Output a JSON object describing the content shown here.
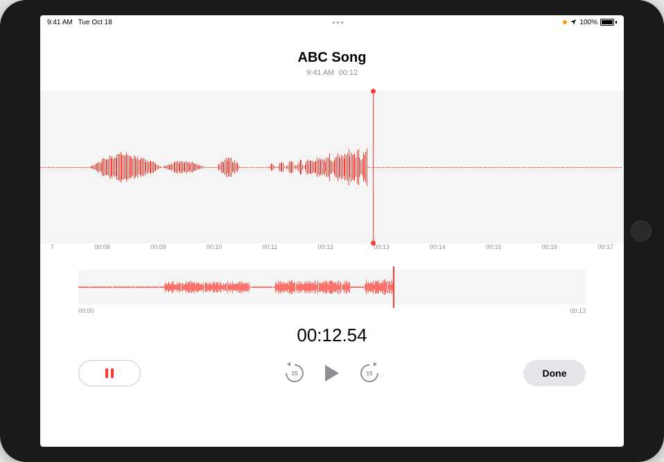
{
  "status_bar": {
    "time": "9:41 AM",
    "date": "Tue Oct 18",
    "battery_percent": "100%"
  },
  "recording": {
    "title": "ABC Song",
    "meta_time": "9:41 AM",
    "meta_duration": "00:12",
    "current_time": "00:12.54"
  },
  "ruler": {
    "marks": [
      "7",
      "00:08",
      "00:09",
      "00:10",
      "00:11",
      "00:12",
      "00:13",
      "00:14",
      "00:15",
      "00:16",
      "00:17"
    ]
  },
  "overview": {
    "start": "00:00",
    "end": "00:13"
  },
  "controls": {
    "skip_back_label": "15",
    "skip_forward_label": "15",
    "done_label": "Done"
  }
}
